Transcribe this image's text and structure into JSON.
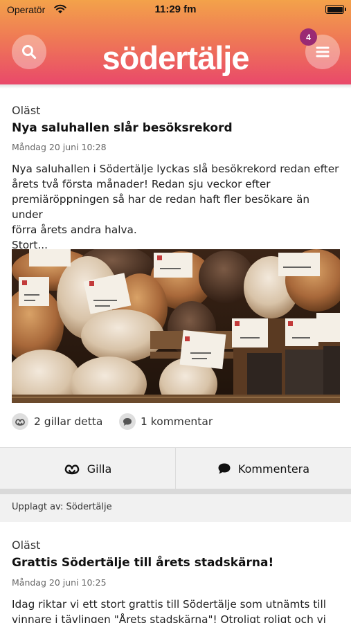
{
  "status_bar": {
    "carrier": "Operatör",
    "time": "11:29 fm"
  },
  "header": {
    "logo_text": "södertälje",
    "notification_count": "4"
  },
  "posts": [
    {
      "status": "Oläst",
      "title": "Nya saluhallen slår besöksrekord",
      "date": "Måndag 20 juni 10:28",
      "body_lines": [
        "Nya saluhallen i Södertälje lyckas slå besökrekord redan efter",
        "årets två första månader! Redan sju veckor efter",
        "premiäröppningen så har de redan haft fler besökare än under",
        "förra årets andra halva.",
        "Stort..."
      ],
      "likes_text": "2 gillar detta",
      "comments_text": "1 kommentar",
      "like_button": "Gilla",
      "comment_button": "Kommentera",
      "posted_by": "Upplagt av: Södertälje"
    },
    {
      "status": "Oläst",
      "title": "Grattis Södertälje till årets stadskärna!",
      "date": "Måndag 20 juni 10:25",
      "body_lines": [
        "Idag riktar vi ett stort grattis till Södertälje som utnämts till",
        "vinnare i tävlingen \"Årets stadskärna\"! Otroligt roligt och vi"
      ]
    }
  ],
  "colors": {
    "gradient_top": "#f3a24a",
    "gradient_bottom": "#e9496a",
    "badge": "#9a2a73"
  }
}
